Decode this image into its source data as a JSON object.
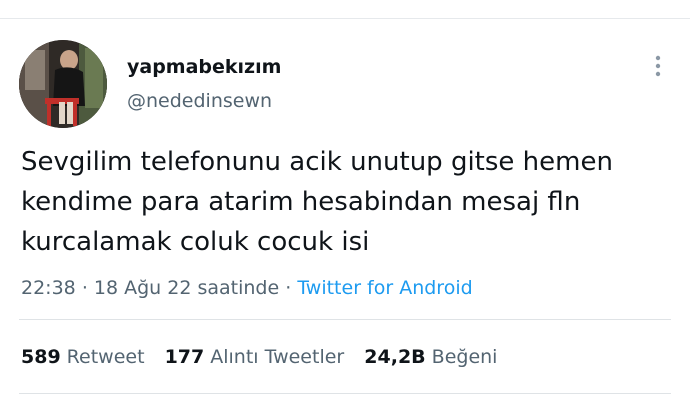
{
  "user": {
    "display_name": "yapmabekızım",
    "handle": "@nededinsewn"
  },
  "tweet": {
    "text": "Sevgilim telefonunu acik unutup gitse hemen kendime para atarim hesabindan mesaj fln kurcalamak coluk cocuk isi",
    "time": "22:38",
    "separator": "·",
    "date": "18 Ağu 22 saatinde",
    "source": "Twitter for Android"
  },
  "stats": {
    "retweets_count": "589",
    "retweets_label": "Retweet",
    "quotes_count": "177",
    "quotes_label": "Alıntı Tweetler",
    "likes_count": "24,2B",
    "likes_label": "Beğeni"
  },
  "colors": {
    "text_primary": "#0f1419",
    "text_secondary": "#536471",
    "link": "#1d9bf0",
    "divider": "#dfe3e6"
  },
  "icons": {
    "more": "more-vertical-icon"
  }
}
